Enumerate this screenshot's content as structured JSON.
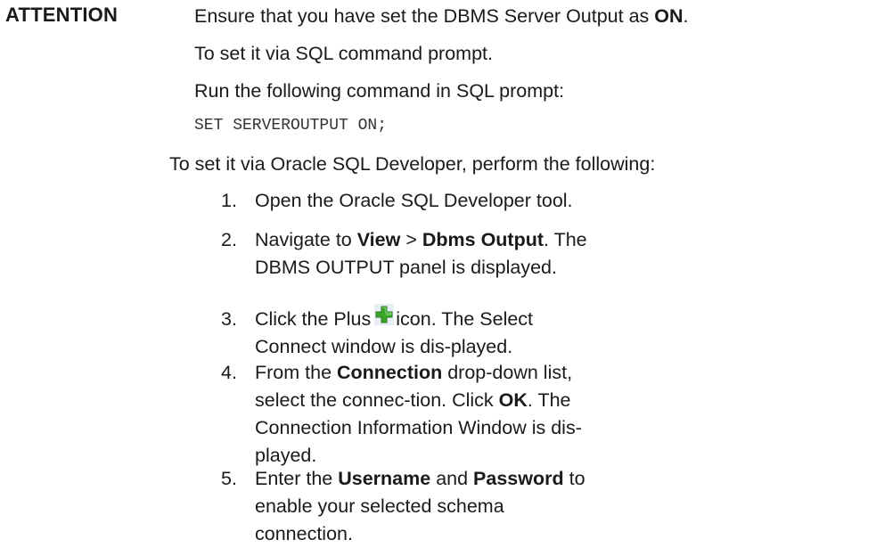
{
  "label": "ATTENTION",
  "lines": {
    "l1_pre": "Ensure that you have set the DBMS Server Output as ",
    "l1_bold": "ON",
    "l1_post": ".",
    "l2": "To set it via SQL command prompt.",
    "l3": "Run the following command in SQL prompt:",
    "code": "SET SERVEROUTPUT ON;",
    "l4": "To set it via Oracle SQL Developer, perform the following:"
  },
  "steps": [
    {
      "num": "1.",
      "t1": "Open the Oracle SQL Developer tool."
    },
    {
      "num": "2.",
      "t1": "Navigate to ",
      "b1": "View",
      "t2": " > ",
      "b2": "Dbms Output",
      "t3": ". The DBMS OUTPUT panel is displayed."
    },
    {
      "num": "3.",
      "t1": "Click the Plus",
      "icon": "plus-icon",
      "t2": "icon. The Select Connect window is dis-played."
    },
    {
      "num": "4.",
      "t1": "From the ",
      "b1": "Connection",
      "t2": " drop-down list, select the connec-tion. Click ",
      "b2": "OK",
      "t3": ". The Connection Information Window is dis-played."
    },
    {
      "num": "5.",
      "t1": "Enter the ",
      "b1": "Username",
      "t2": " and ",
      "b2": "Password",
      "t3": " to enable your selected schema connection."
    }
  ],
  "colors": {
    "icon_green": "#3aa62a",
    "icon_bg": "#e8eef6"
  }
}
